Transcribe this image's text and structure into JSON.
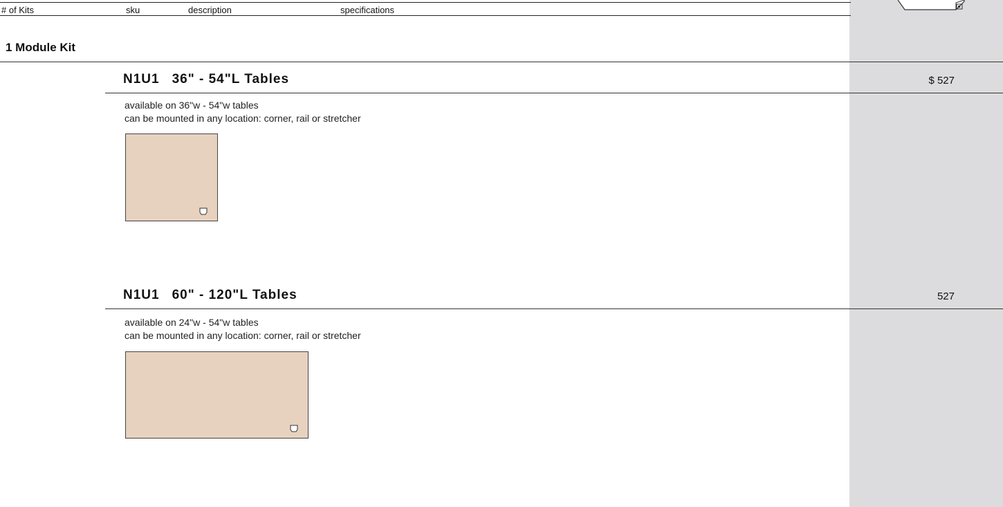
{
  "header": {
    "columns": [
      "# of Kits",
      "sku",
      "description",
      "specifications"
    ]
  },
  "section": {
    "title": "1 Module Kit"
  },
  "products": [
    {
      "sku": "N1U1",
      "name": "36\" - 54\"L Tables",
      "price": "$ 527",
      "lines": [
        "available on 36\"w - 54\"w tables",
        "can be mounted in any location: corner, rail or stretcher"
      ]
    },
    {
      "sku": "N1U1",
      "name": "60\" - 120\"L Tables",
      "price": "527",
      "lines": [
        "available on 24\"w - 54\"w tables",
        "can be mounted in any location: corner, rail or stretcher"
      ]
    }
  ],
  "colors": {
    "price_column_bg": "#dcdcde",
    "table_fill": "#e7d2bf"
  },
  "icons": [
    "power-unit-icon",
    "outlet-icon"
  ]
}
